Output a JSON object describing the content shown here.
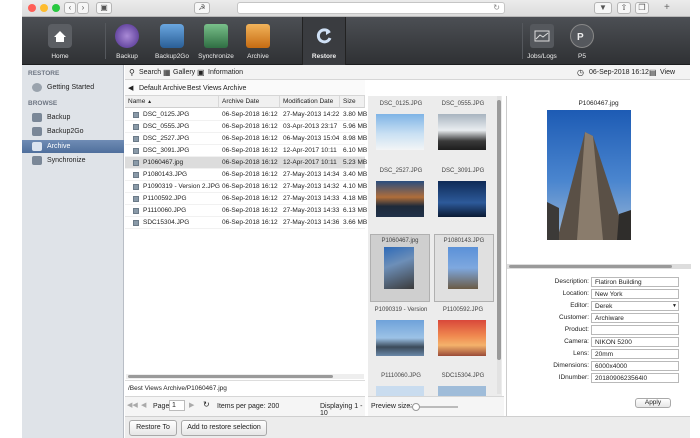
{
  "toolbar": {
    "items": [
      {
        "label": "Home",
        "icon": "home-icon"
      },
      {
        "label": "Backup",
        "icon": "backup-icon"
      },
      {
        "label": "Backup2Go",
        "icon": "backup2go-icon"
      },
      {
        "label": "Synchronize",
        "icon": "synchronize-icon"
      },
      {
        "label": "Archive",
        "icon": "archive-icon"
      },
      {
        "label": "Restore",
        "icon": "restore-icon",
        "selected": true
      },
      {
        "label": "Jobs/Logs",
        "icon": "jobs-logs-icon"
      },
      {
        "label": "P5",
        "icon": "p5-icon"
      }
    ]
  },
  "sidebar": {
    "restore_header": "RESTORE",
    "getting_started": "Getting Started",
    "browse_header": "BROWSE",
    "items": [
      {
        "label": "Backup"
      },
      {
        "label": "Backup2Go"
      },
      {
        "label": "Archive",
        "active": true
      },
      {
        "label": "Synchronize"
      }
    ]
  },
  "content_toolbar": {
    "search": "Search",
    "gallery": "Gallery",
    "information": "Information",
    "date": "06-Sep-2018 16:12",
    "view": "View"
  },
  "breadcrumb": {
    "first": "Default Archive",
    "second": "Best Views Archive"
  },
  "table": {
    "columns": [
      "Name",
      "Archive Date",
      "Modification Date",
      "Size"
    ],
    "rows": [
      {
        "name": "DSC_0125.JPG",
        "archive": "06-Sep-2018 16:12",
        "modified": "27-May-2013 14:22",
        "size": "3.80 MB"
      },
      {
        "name": "DSC_0555.JPG",
        "archive": "06-Sep-2018 16:12",
        "modified": "03-Apr-2013 23:17",
        "size": "5.96 MB"
      },
      {
        "name": "DSC_2527.JPG",
        "archive": "06-Sep-2018 16:12",
        "modified": "06-May-2013 15:04",
        "size": "8.98 MB"
      },
      {
        "name": "DSC_3091.JPG",
        "archive": "06-Sep-2018 16:12",
        "modified": "12-Apr-2017 10:11",
        "size": "6.10 MB"
      },
      {
        "name": "P1060467.jpg",
        "archive": "06-Sep-2018 16:12",
        "modified": "12-Apr-2017 10:11",
        "size": "5.23 MB",
        "selected": true
      },
      {
        "name": "P1080143.JPG",
        "archive": "06-Sep-2018 16:12",
        "modified": "27-May-2013 14:34",
        "size": "3.40 MB"
      },
      {
        "name": "P1090319 - Version 2.JPG",
        "archive": "06-Sep-2018 16:12",
        "modified": "27-May-2013 14:32",
        "size": "4.10 MB"
      },
      {
        "name": "P1100592.JPG",
        "archive": "06-Sep-2018 16:12",
        "modified": "27-May-2013 14:33",
        "size": "4.18 MB"
      },
      {
        "name": "P1110060.JPG",
        "archive": "06-Sep-2018 16:12",
        "modified": "27-May-2013 14:33",
        "size": "6.13 MB"
      },
      {
        "name": "SDC15304.JPG",
        "archive": "06-Sep-2018 16:12",
        "modified": "27-May-2013 14:36",
        "size": "3.66 MB"
      }
    ]
  },
  "path_status": "/Best Views Archive/P1060467.jpg",
  "pager": {
    "page_label": "Page",
    "page_value": "1",
    "items_per_page": "Items per page: 200",
    "displaying": "Displaying 1 - 10"
  },
  "thumbnails": [
    {
      "name": "DSC_0125.JPG"
    },
    {
      "name": "DSC_0555.JPG"
    },
    {
      "name": "DSC_2527.JPG"
    },
    {
      "name": "DSC_3091.JPG"
    },
    {
      "name": "P1060467.jpg",
      "selected": true
    },
    {
      "name": "P1080143.JPG"
    },
    {
      "name": "P1090319 - Version"
    },
    {
      "name": "P1100592.JPG"
    },
    {
      "name": "P1110060.JPG"
    },
    {
      "name": "SDC15304.JPG"
    }
  ],
  "preview_size_label": "Preview size:",
  "detail": {
    "image_name": "P1060467.jpg",
    "fields": [
      {
        "label": "Description:",
        "value": "Flatiron Building"
      },
      {
        "label": "Location:",
        "value": "New York"
      },
      {
        "label": "Editor:",
        "value": "Derek"
      },
      {
        "label": "Customer:",
        "value": "Archiware"
      },
      {
        "label": "Product:",
        "value": ""
      },
      {
        "label": "Camera:",
        "value": "NIKON 5200"
      },
      {
        "label": "Lens:",
        "value": "20mm"
      },
      {
        "label": "Dimensions:",
        "value": "6000x4000"
      },
      {
        "label": "IDnumber:",
        "value": "2018090623564l0"
      }
    ],
    "apply": "Apply"
  },
  "bottom": {
    "restore_to": "Restore To",
    "add_to_selection": "Add to restore selection"
  }
}
